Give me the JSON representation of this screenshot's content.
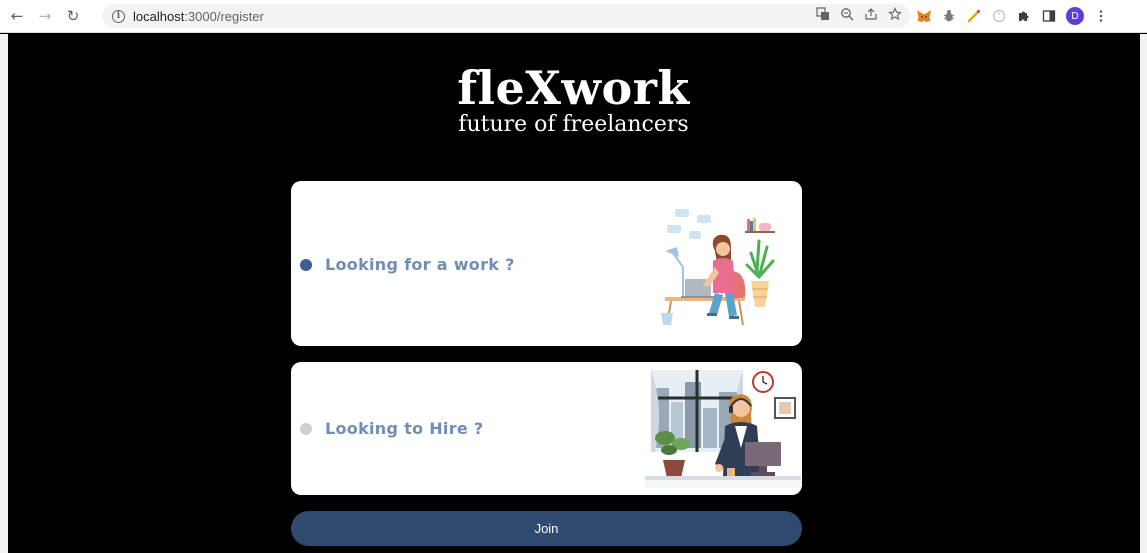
{
  "browser": {
    "url_host": "localhost",
    "url_rest": ":3000/register",
    "avatar_letter": "D"
  },
  "brand": {
    "logo": "fleXwork",
    "tagline": "future of freelancers"
  },
  "options": [
    {
      "label": "Looking for a work ?",
      "selected": true
    },
    {
      "label": "Looking to Hire ?",
      "selected": false
    }
  ],
  "join_label": "Join",
  "colors": {
    "background": "#000000",
    "card": "#ffffff",
    "label": "#6f8db5",
    "radio_selected": "#3b5f92",
    "radio_unselected": "#cfcfcf",
    "join_button": "#2f4a6e"
  }
}
